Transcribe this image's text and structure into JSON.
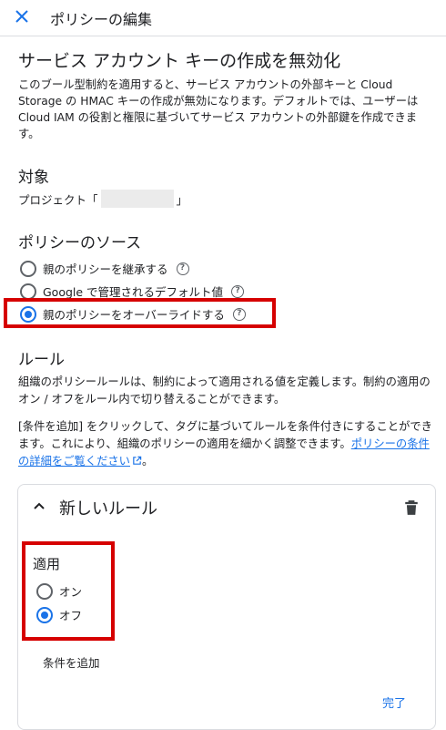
{
  "header": {
    "title": "ポリシーの編集"
  },
  "policy": {
    "title": "サービス アカウント キーの作成を無効化",
    "description": "このブール型制約を適用すると、サービス アカウントの外部キーと Cloud Storage の HMAC キーの作成が無効になります。デフォルトでは、ユーザーは Cloud IAM の役割と権限に基づいてサービス アカウントの外部鍵を作成できます。"
  },
  "target": {
    "heading": "対象",
    "prefix": "プロジェクト「",
    "suffix": "」"
  },
  "source": {
    "heading": "ポリシーのソース",
    "options": [
      {
        "label": "親のポリシーを継承する",
        "selected": false
      },
      {
        "label": "Google で管理されるデフォルト値",
        "selected": false
      },
      {
        "label": "親のポリシーをオーバーライドする",
        "selected": true
      }
    ]
  },
  "rules": {
    "heading": "ルール",
    "para1": "組織のポリシールールは、制約によって適用される値を定義します。制約の適用のオン / オフをルール内で切り替えることができます。",
    "para2": "[条件を追加] をクリックして、タグに基づいてルールを条件付きにすることができます。これにより、組織のポリシーの適用を細かく調整できます。",
    "link": "ポリシーの条件の詳細をご覧ください",
    "after_link": "。"
  },
  "rule_card": {
    "title": "新しいルール",
    "enforcement_label": "適用",
    "options": [
      {
        "label": "オン",
        "selected": false
      },
      {
        "label": "オフ",
        "selected": true
      }
    ],
    "add_condition": "条件を追加",
    "done": "完了"
  },
  "colors": {
    "accent": "#1a73e8",
    "highlight": "#d60000",
    "text": "#202124"
  },
  "icons": [
    "close-icon",
    "help-icon",
    "external-link-icon",
    "chevron-up-icon",
    "trash-icon"
  ]
}
